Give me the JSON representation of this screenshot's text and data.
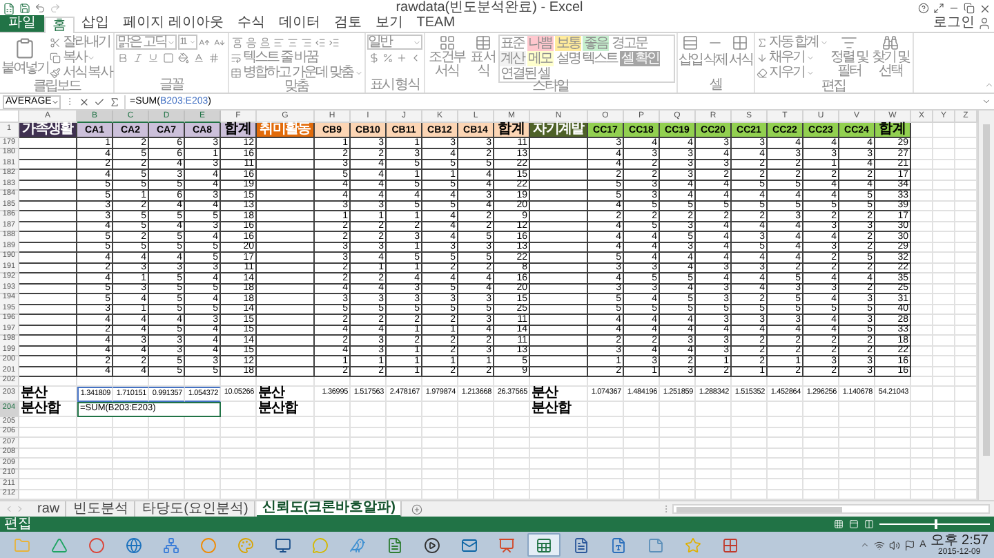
{
  "window": {
    "title": "rawdata(빈도분석완료) - Excel"
  },
  "menu_tabs": [
    {
      "label": "파일",
      "kind": "file",
      "selected": false
    },
    {
      "label": "홈",
      "kind": "tab",
      "selected": true
    },
    {
      "label": "삽입",
      "kind": "tab",
      "selected": false
    },
    {
      "label": "페이지 레이아웃",
      "kind": "tab",
      "selected": false
    },
    {
      "label": "수식",
      "kind": "tab",
      "selected": false
    },
    {
      "label": "데이터",
      "kind": "tab",
      "selected": false
    },
    {
      "label": "검토",
      "kind": "tab",
      "selected": false
    },
    {
      "label": "보기",
      "kind": "tab",
      "selected": false
    },
    {
      "label": "TEAM",
      "kind": "tab",
      "selected": false
    }
  ],
  "account": "로그인",
  "ribbon": {
    "disabled": true,
    "groups": [
      {
        "kind": "clipboard",
        "label": "클립보드",
        "items": [
          "붙여넣기",
          "잘라내기",
          "복사",
          "서식 복사"
        ]
      },
      {
        "kind": "font",
        "label": "글꼴",
        "font": "맑은 고딕",
        "size": "11"
      },
      {
        "kind": "alignment",
        "label": "맞춤",
        "items": [
          "텍스트 줄 바꿈",
          "병합하고 가운데 맞춤"
        ]
      },
      {
        "kind": "number",
        "label": "표시 형식",
        "format": "일반"
      },
      {
        "kind": "styles",
        "label": "스타일",
        "items": [
          "조건부 서식",
          "표 서식"
        ],
        "gallery": [
          {
            "label": "표준",
            "color": "#ffffff"
          },
          {
            "label": "나쁨",
            "color": "#ffc7ce"
          },
          {
            "label": "보통",
            "color": "#ffeb9c"
          },
          {
            "label": "좋음",
            "color": "#c6efce"
          },
          {
            "label": "경고문",
            "color": "#ffffff"
          },
          {
            "label": "계산",
            "color": "#f2f2f2"
          },
          {
            "label": "메모",
            "color": "#ffffcc"
          },
          {
            "label": "설명 텍스트",
            "color": "#ffffff"
          },
          {
            "label": "셀 확인",
            "color": "#a5a5a5"
          },
          {
            "label": "연결된 셀",
            "color": "#ffffff"
          }
        ]
      },
      {
        "kind": "cells",
        "label": "셀",
        "items": [
          "삽입",
          "삭제",
          "서식"
        ]
      },
      {
        "kind": "editing",
        "label": "편집",
        "items": [
          "자동 합계",
          "채우기",
          "지우기",
          "정렬 및 필터",
          "찾기 및 선택"
        ]
      }
    ]
  },
  "formula_bar": {
    "name_box": "AVERAGE",
    "formula": [
      {
        "text": "=SUM(",
        "kind": "plain"
      },
      {
        "text": "B203:E203",
        "kind": "reference"
      },
      {
        "text": ")",
        "kind": "plain"
      }
    ]
  },
  "columns": [
    {
      "letter": "A",
      "selected": false
    },
    {
      "letter": "B",
      "selected": true
    },
    {
      "letter": "C",
      "selected": true
    },
    {
      "letter": "D",
      "selected": true
    },
    {
      "letter": "E",
      "selected": true
    },
    {
      "letter": "F",
      "selected": false
    },
    {
      "letter": "G",
      "selected": false
    },
    {
      "letter": "H",
      "selected": false
    },
    {
      "letter": "I",
      "selected": false
    },
    {
      "letter": "J",
      "selected": false
    },
    {
      "letter": "K",
      "selected": false
    },
    {
      "letter": "L",
      "selected": false
    },
    {
      "letter": "M",
      "selected": false
    },
    {
      "letter": "N",
      "selected": false
    },
    {
      "letter": "O",
      "selected": false
    },
    {
      "letter": "P",
      "selected": false
    },
    {
      "letter": "Q",
      "selected": false
    },
    {
      "letter": "R",
      "selected": false
    },
    {
      "letter": "S",
      "selected": false
    },
    {
      "letter": "T",
      "selected": false
    },
    {
      "letter": "U",
      "selected": false
    },
    {
      "letter": "V",
      "selected": false
    },
    {
      "letter": "W",
      "selected": false
    },
    {
      "letter": "X",
      "selected": false
    },
    {
      "letter": "Y",
      "selected": false
    },
    {
      "letter": "Z",
      "selected": false
    }
  ],
  "header_row": {
    "number": "1",
    "selected": false,
    "blocks": [
      {
        "category": {
          "text": "가족생활",
          "color": "#403151"
        },
        "items": [
          {
            "text": "CA1",
            "color": "#ccc0da"
          },
          {
            "text": "CA2",
            "color": "#ccc0da"
          },
          {
            "text": "CA7",
            "color": "#ccc0da"
          },
          {
            "text": "CA8",
            "color": "#ccc0da"
          }
        ],
        "total": {
          "text": "합계",
          "color": "#ccc0da"
        }
      },
      {
        "category": {
          "text": "취미활동",
          "color": "#e26b0a"
        },
        "items": [
          {
            "text": "CB9",
            "color": "#fcd5b4"
          },
          {
            "text": "CB10",
            "color": "#fcd5b4"
          },
          {
            "text": "CB11",
            "color": "#fcd5b4"
          },
          {
            "text": "CB12",
            "color": "#fcd5b4"
          },
          {
            "text": "CB14",
            "color": "#fcd5b4"
          }
        ],
        "total": {
          "text": "합계",
          "color": "#fcd5b4"
        }
      },
      {
        "category": {
          "text": "자기계발",
          "color": "#4f6228"
        },
        "items": [
          {
            "text": "CC17",
            "color": "#92d050"
          },
          {
            "text": "CC18",
            "color": "#92d050"
          },
          {
            "text": "CC19",
            "color": "#92d050"
          },
          {
            "text": "CC20",
            "color": "#92d050"
          },
          {
            "text": "CC21",
            "color": "#92d050"
          },
          {
            "text": "CC22",
            "color": "#92d050"
          },
          {
            "text": "CC23",
            "color": "#92d050"
          },
          {
            "text": "CC24",
            "color": "#92d050"
          }
        ],
        "total": {
          "text": "합계",
          "color": "#92d050"
        }
      }
    ]
  },
  "rows": [
    {
      "number": "179",
      "selected": false,
      "kind": "data",
      "blocks": [
        [
          "1",
          "2",
          "6",
          "3",
          "12"
        ],
        [
          "1",
          "3",
          "1",
          "3",
          "3",
          "11"
        ],
        [
          "3",
          "4",
          "4",
          "3",
          "3",
          "4",
          "4",
          "4",
          "29"
        ]
      ]
    },
    {
      "number": "180",
      "selected": false,
      "kind": "data",
      "blocks": [
        [
          "4",
          "5",
          "6",
          "1",
          "16"
        ],
        [
          "2",
          "2",
          "3",
          "4",
          "2",
          "13"
        ],
        [
          "4",
          "3",
          "3",
          "4",
          "4",
          "3",
          "3",
          "3",
          "27"
        ]
      ]
    },
    {
      "number": "181",
      "selected": false,
      "kind": "data",
      "blocks": [
        [
          "2",
          "2",
          "4",
          "3",
          "11"
        ],
        [
          "3",
          "4",
          "5",
          "5",
          "5",
          "22"
        ],
        [
          "4",
          "2",
          "3",
          "3",
          "2",
          "2",
          "1",
          "4",
          "21"
        ]
      ]
    },
    {
      "number": "182",
      "selected": false,
      "kind": "data",
      "blocks": [
        [
          "4",
          "5",
          "3",
          "4",
          "16"
        ],
        [
          "5",
          "4",
          "1",
          "1",
          "4",
          "15"
        ],
        [
          "2",
          "2",
          "3",
          "2",
          "2",
          "2",
          "2",
          "2",
          "17"
        ]
      ]
    },
    {
      "number": "183",
      "selected": false,
      "kind": "data",
      "blocks": [
        [
          "5",
          "5",
          "5",
          "4",
          "19"
        ],
        [
          "4",
          "4",
          "5",
          "5",
          "4",
          "22"
        ],
        [
          "5",
          "3",
          "4",
          "4",
          "5",
          "5",
          "4",
          "4",
          "34"
        ]
      ]
    },
    {
      "number": "184",
      "selected": false,
      "kind": "data",
      "blocks": [
        [
          "5",
          "1",
          "6",
          "3",
          "15"
        ],
        [
          "4",
          "4",
          "4",
          "4",
          "3",
          "19"
        ],
        [
          "5",
          "3",
          "4",
          "4",
          "4",
          "4",
          "4",
          "5",
          "33"
        ]
      ]
    },
    {
      "number": "185",
      "selected": false,
      "kind": "data",
      "blocks": [
        [
          "3",
          "2",
          "4",
          "4",
          "13"
        ],
        [
          "3",
          "3",
          "5",
          "5",
          "4",
          "20"
        ],
        [
          "4",
          "5",
          "5",
          "5",
          "5",
          "5",
          "5",
          "5",
          "39"
        ]
      ]
    },
    {
      "number": "186",
      "selected": false,
      "kind": "data",
      "blocks": [
        [
          "3",
          "5",
          "5",
          "5",
          "18"
        ],
        [
          "1",
          "1",
          "1",
          "4",
          "2",
          "9"
        ],
        [
          "2",
          "2",
          "2",
          "2",
          "2",
          "3",
          "2",
          "2",
          "17"
        ]
      ]
    },
    {
      "number": "187",
      "selected": false,
      "kind": "data",
      "blocks": [
        [
          "4",
          "5",
          "4",
          "3",
          "16"
        ],
        [
          "2",
          "2",
          "2",
          "4",
          "2",
          "12"
        ],
        [
          "4",
          "5",
          "3",
          "4",
          "4",
          "4",
          "3",
          "3",
          "30"
        ]
      ]
    },
    {
      "number": "188",
      "selected": false,
      "kind": "data",
      "blocks": [
        [
          "5",
          "2",
          "5",
          "4",
          "16"
        ],
        [
          "2",
          "2",
          "3",
          "4",
          "5",
          "16"
        ],
        [
          "4",
          "4",
          "5",
          "4",
          "3",
          "4",
          "4",
          "2",
          "30"
        ]
      ]
    },
    {
      "number": "189",
      "selected": false,
      "kind": "data",
      "blocks": [
        [
          "5",
          "5",
          "5",
          "5",
          "20"
        ],
        [
          "3",
          "3",
          "1",
          "3",
          "3",
          "13"
        ],
        [
          "4",
          "4",
          "3",
          "4",
          "5",
          "4",
          "3",
          "2",
          "29"
        ]
      ]
    },
    {
      "number": "190",
      "selected": false,
      "kind": "data",
      "blocks": [
        [
          "4",
          "4",
          "4",
          "5",
          "17"
        ],
        [
          "3",
          "4",
          "5",
          "5",
          "5",
          "22"
        ],
        [
          "5",
          "4",
          "4",
          "4",
          "4",
          "4",
          "2",
          "5",
          "32"
        ]
      ]
    },
    {
      "number": "191",
      "selected": false,
      "kind": "data",
      "blocks": [
        [
          "2",
          "3",
          "3",
          "3",
          "11"
        ],
        [
          "2",
          "1",
          "1",
          "2",
          "2",
          "8"
        ],
        [
          "3",
          "3",
          "4",
          "3",
          "3",
          "2",
          "2",
          "2",
          "22"
        ]
      ]
    },
    {
      "number": "192",
      "selected": false,
      "kind": "data",
      "blocks": [
        [
          "4",
          "1",
          "5",
          "4",
          "14"
        ],
        [
          "2",
          "2",
          "4",
          "4",
          "4",
          "16"
        ],
        [
          "4",
          "5",
          "5",
          "4",
          "4",
          "5",
          "4",
          "4",
          "35"
        ]
      ]
    },
    {
      "number": "193",
      "selected": false,
      "kind": "data",
      "blocks": [
        [
          "5",
          "3",
          "5",
          "5",
          "18"
        ],
        [
          "4",
          "4",
          "3",
          "5",
          "4",
          "20"
        ],
        [
          "3",
          "3",
          "4",
          "3",
          "4",
          "3",
          "3",
          "2",
          "25"
        ]
      ]
    },
    {
      "number": "194",
      "selected": false,
      "kind": "data",
      "blocks": [
        [
          "5",
          "4",
          "5",
          "4",
          "18"
        ],
        [
          "3",
          "3",
          "3",
          "3",
          "3",
          "15"
        ],
        [
          "5",
          "4",
          "5",
          "3",
          "2",
          "5",
          "4",
          "3",
          "31"
        ]
      ]
    },
    {
      "number": "195",
      "selected": false,
      "kind": "data",
      "blocks": [
        [
          "3",
          "1",
          "5",
          "5",
          "14"
        ],
        [
          "5",
          "5",
          "5",
          "5",
          "5",
          "25"
        ],
        [
          "5",
          "5",
          "5",
          "5",
          "5",
          "5",
          "5",
          "5",
          "40"
        ]
      ]
    },
    {
      "number": "196",
      "selected": false,
      "kind": "data",
      "blocks": [
        [
          "4",
          "4",
          "4",
          "3",
          "15"
        ],
        [
          "2",
          "2",
          "2",
          "2",
          "3",
          "11"
        ],
        [
          "4",
          "4",
          "4",
          "3",
          "3",
          "3",
          "4",
          "3",
          "28"
        ]
      ]
    },
    {
      "number": "197",
      "selected": false,
      "kind": "data",
      "blocks": [
        [
          "2",
          "4",
          "5",
          "4",
          "15"
        ],
        [
          "4",
          "4",
          "1",
          "1",
          "4",
          "14"
        ],
        [
          "4",
          "4",
          "4",
          "4",
          "4",
          "4",
          "4",
          "5",
          "33"
        ]
      ]
    },
    {
      "number": "198",
      "selected": false,
      "kind": "data",
      "blocks": [
        [
          "4",
          "3",
          "3",
          "4",
          "14"
        ],
        [
          "2",
          "3",
          "2",
          "2",
          "2",
          "11"
        ],
        [
          "2",
          "2",
          "3",
          "3",
          "2",
          "2",
          "2",
          "2",
          "18"
        ]
      ]
    },
    {
      "number": "199",
      "selected": false,
      "kind": "data",
      "blocks": [
        [
          "4",
          "4",
          "3",
          "4",
          "15"
        ],
        [
          "4",
          "3",
          "1",
          "2",
          "3",
          "13"
        ],
        [
          "3",
          "4",
          "4",
          "3",
          "2",
          "2",
          "2",
          "2",
          "22"
        ]
      ]
    },
    {
      "number": "200",
      "selected": false,
      "kind": "data",
      "blocks": [
        [
          "2",
          "2",
          "5",
          "3",
          "12"
        ],
        [
          "1",
          "1",
          "1",
          "1",
          "1",
          "5"
        ],
        [
          "1",
          "3",
          "2",
          "1",
          "2",
          "1",
          "3",
          "3",
          "16"
        ]
      ]
    },
    {
      "number": "201",
      "selected": false,
      "kind": "data",
      "blocks": [
        [
          "4",
          "4",
          "5",
          "5",
          "18"
        ],
        [
          "2",
          "2",
          "1",
          "2",
          "2",
          "9"
        ],
        [
          "2",
          "1",
          "3",
          "2",
          "1",
          "2",
          "2",
          "3",
          "16"
        ]
      ]
    },
    {
      "number": "202",
      "selected": false,
      "kind": "blank"
    },
    {
      "number": "203",
      "selected": false,
      "kind": "summary",
      "referenced": true,
      "labels": [
        "분산",
        "분산",
        "분산"
      ],
      "blocks": [
        [
          "1.341809",
          "1.710151",
          "0.991357",
          "1.054372",
          "10.05266"
        ],
        [
          "1.36995",
          "1.517563",
          "2.478167",
          "1.979874",
          "1.213668",
          "26.37565"
        ],
        [
          "1.074367",
          "1.484196",
          "1.251859",
          "1.288342",
          "1.515352",
          "1.452864",
          "1.296256",
          "1.140678",
          "54.21043"
        ]
      ]
    },
    {
      "number": "204",
      "selected": true,
      "kind": "summary",
      "labels": [
        "분산합",
        "분산합",
        "분산합"
      ],
      "edit_cell": {
        "text": "=SUM(B203:E203)"
      }
    },
    {
      "number": "205",
      "selected": false,
      "kind": "blank"
    },
    {
      "number": "206",
      "selected": false,
      "kind": "blank"
    },
    {
      "number": "207",
      "selected": false,
      "kind": "blank"
    },
    {
      "number": "208",
      "selected": false,
      "kind": "blank"
    },
    {
      "number": "209",
      "selected": false,
      "kind": "blank"
    },
    {
      "number": "210",
      "selected": false,
      "kind": "blank"
    },
    {
      "number": "211",
      "selected": false,
      "kind": "blank"
    },
    {
      "number": "212",
      "selected": false,
      "kind": "blank"
    }
  ],
  "sheet_tabs": [
    {
      "label": "raw",
      "selected": false
    },
    {
      "label": "빈도분석",
      "selected": false
    },
    {
      "label": "타당도(요인분석)",
      "selected": false
    },
    {
      "label": "신뢰도(크론바흐알파)",
      "selected": true
    }
  ],
  "status_bar": {
    "mode": "편집",
    "zoom_slider": {
      "level": 0.5
    }
  },
  "taskbar": {
    "apps": [
      {
        "kind": "folder",
        "selected": false
      },
      {
        "kind": "drive",
        "selected": false
      },
      {
        "kind": "browser",
        "selected": false
      },
      {
        "kind": "globe",
        "selected": false
      },
      {
        "kind": "network",
        "selected": false
      },
      {
        "kind": "ball",
        "selected": false
      },
      {
        "kind": "palette",
        "selected": false
      },
      {
        "kind": "monitor",
        "selected": false
      },
      {
        "kind": "chat",
        "selected": false
      },
      {
        "kind": "bird",
        "selected": false
      },
      {
        "kind": "document",
        "selected": false
      },
      {
        "kind": "player",
        "selected": false
      },
      {
        "kind": "mail",
        "selected": false
      },
      {
        "kind": "slides",
        "selected": false
      },
      {
        "kind": "sheet",
        "selected": true
      },
      {
        "kind": "word",
        "selected": false
      },
      {
        "kind": "hangul",
        "selected": false
      },
      {
        "kind": "notes",
        "selected": false
      },
      {
        "kind": "star",
        "selected": false
      },
      {
        "kind": "grid",
        "selected": false
      }
    ],
    "ime": "A",
    "time": "오후 2:57",
    "date": "2015-12-09"
  }
}
